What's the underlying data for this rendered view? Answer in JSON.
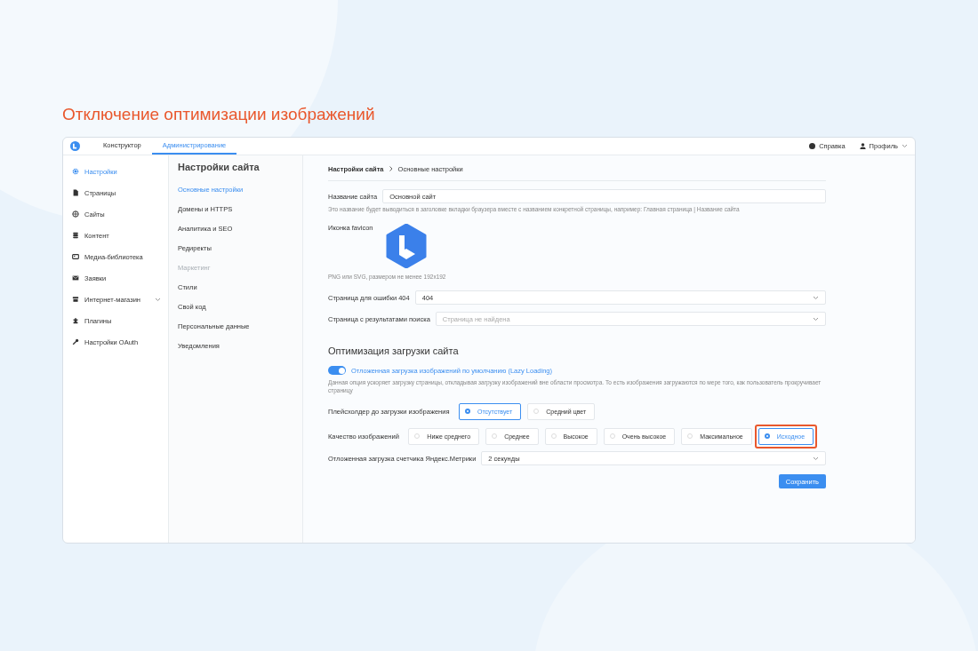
{
  "slide_title": "Отключение оптимизации изображений",
  "topbar": {
    "tabs": [
      {
        "label": "Конструктор",
        "selected": false
      },
      {
        "label": "Администрирование",
        "selected": true
      }
    ],
    "help": "Справка",
    "profile": "Профиль"
  },
  "sidebar": {
    "items": [
      {
        "label": "Настройки",
        "selected": true,
        "expandable": false
      },
      {
        "label": "Страницы",
        "selected": false,
        "expandable": false
      },
      {
        "label": "Сайты",
        "selected": false,
        "expandable": false
      },
      {
        "label": "Контент",
        "selected": false,
        "expandable": false
      },
      {
        "label": "Медиа-библиотека",
        "selected": false,
        "expandable": false
      },
      {
        "label": "Заявки",
        "selected": false,
        "expandable": false
      },
      {
        "label": "Интернет-магазин",
        "selected": false,
        "expandable": true
      },
      {
        "label": "Плагины",
        "selected": false,
        "expandable": false
      },
      {
        "label": "Настройки OAuth",
        "selected": false,
        "expandable": false
      }
    ]
  },
  "submenu": {
    "title": "Настройки сайта",
    "items": [
      {
        "label": "Основные настройки",
        "selected": true,
        "disabled": false
      },
      {
        "label": "Домены и HTTPS",
        "selected": false,
        "disabled": false
      },
      {
        "label": "Аналитика и SEO",
        "selected": false,
        "disabled": false
      },
      {
        "label": "Редиректы",
        "selected": false,
        "disabled": false
      },
      {
        "label": "Маркетинг",
        "selected": false,
        "disabled": true
      },
      {
        "label": "Стили",
        "selected": false,
        "disabled": false
      },
      {
        "label": "Свой код",
        "selected": false,
        "disabled": false
      },
      {
        "label": "Персональные данные",
        "selected": false,
        "disabled": false
      },
      {
        "label": "Уведомления",
        "selected": false,
        "disabled": false
      }
    ]
  },
  "breadcrumb": [
    "Настройки сайта",
    "Основные настройки"
  ],
  "site_name": {
    "label": "Название сайта",
    "value": "Основной сайт",
    "hint": "Это название будет выводиться в заголовке вкладки браузера вместе с названием конкретной страницы, например: Главная страница | Название сайта"
  },
  "favicon": {
    "label": "Иконка favicon",
    "hint": "PNG или SVG, размером не менее 192x192"
  },
  "error_page": {
    "label": "Страница для ошибки 404",
    "value": "404"
  },
  "search_page": {
    "label": "Страница с результатами поиска",
    "placeholder": "Страница не найдена"
  },
  "optimization": {
    "heading": "Оптимизация загрузки сайта",
    "lazy": {
      "label": "Отложенная загрузка изображений по умолчанию (Lazy Loading)",
      "on": true,
      "description": "Данная опция ускоряет загрузку страницы, откладывая загрузку изображений вне области просмотра. То есть изображения загружаются по мере того, как пользователь прокручивает страницу"
    },
    "placeholder_option": {
      "label": "Плейсхолдер до загрузки изображения",
      "options": [
        {
          "label": "Отсутствует",
          "selected": true,
          "highlighted": false
        },
        {
          "label": "Средний цвет",
          "selected": false,
          "highlighted": false
        }
      ]
    },
    "quality": {
      "label": "Качество изображений",
      "options": [
        {
          "label": "Ниже среднего",
          "selected": false,
          "highlighted": false
        },
        {
          "label": "Среднее",
          "selected": false,
          "highlighted": false
        },
        {
          "label": "Высокое",
          "selected": false,
          "highlighted": false
        },
        {
          "label": "Очень высокое",
          "selected": false,
          "highlighted": false
        },
        {
          "label": "Максимальное",
          "selected": false,
          "highlighted": false
        },
        {
          "label": "Исходное",
          "selected": true,
          "highlighted": true
        }
      ]
    },
    "metrika": {
      "label": "Отложенная загрузка счетчика Яндекс.Метрики",
      "value": "2 секунды"
    }
  },
  "save_button": "Сохранить"
}
